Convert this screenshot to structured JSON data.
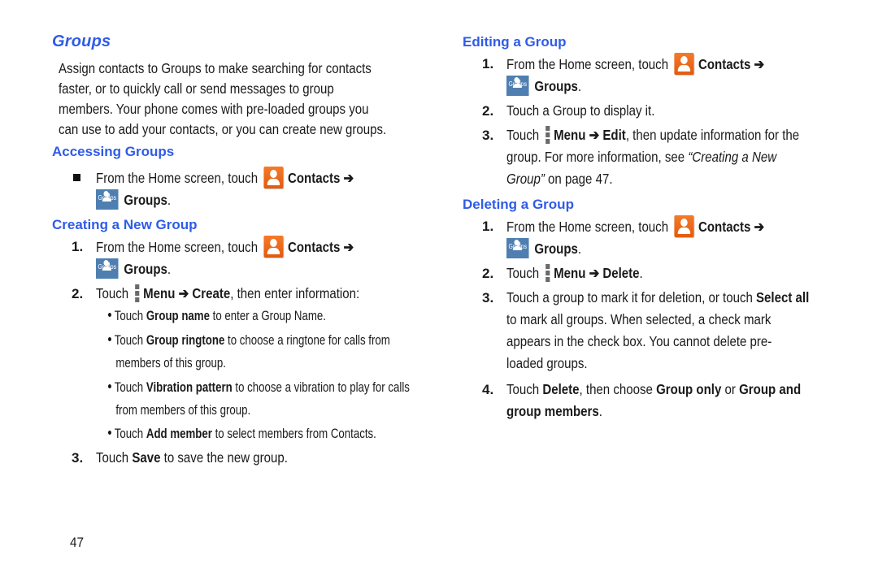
{
  "page": {
    "title": "Groups",
    "intro": [
      "Assign contacts to Groups to make searching for contacts",
      "faster, or to quickly call or send messages to group",
      "members. Your phone comes with pre-loaded groups you",
      "can use to add your contacts, or you can create new groups."
    ],
    "page_number": "47"
  },
  "common": {
    "from_home": "From the Home screen, touch ",
    "contacts": "Contacts",
    "arrow": " ➔",
    "groups": "Groups",
    "period": ".",
    "touch": "Touch ",
    "menu": "Menu",
    "arrow_mid": " ➔ "
  },
  "icons": {
    "contacts": "contacts-app-icon",
    "groups": "groups-app-icon",
    "groups_label": "Groups",
    "menu": "menu-dots-icon",
    "bullet": "square-bullet"
  },
  "accessing": {
    "heading": "Accessing Groups"
  },
  "creating": {
    "heading": "Creating a New Group",
    "step2_action": "Create",
    "step2_rest": ", then enter information:",
    "bullets": [
      {
        "pre": "Touch ",
        "bold": "Group name",
        "post": " to enter a Group Name."
      },
      {
        "pre": "Touch ",
        "bold": "Group ringtone",
        "post": " to choose a ringtone for calls from",
        "line2": "members of this group."
      },
      {
        "pre": "Touch ",
        "bold": "Vibration pattern",
        "post": " to choose a vibration to play for calls",
        "line2": "from members of this group."
      },
      {
        "pre": "Touch ",
        "bold": "Add member",
        "post": " to select members from Contacts."
      }
    ],
    "step3_pre": "Touch ",
    "step3_bold": "Save",
    "step3_post": " to save the new group."
  },
  "editing": {
    "heading": "Editing a Group",
    "step2": "Touch a Group to display it.",
    "step3_action": "Edit",
    "step3_rest": ", then update information for the",
    "step3_line2_pre": "group. For more information, see ",
    "step3_line2_ref": "“Creating a New",
    "step3_line3_ref": "Group”",
    "step3_line3_post": " on page 47."
  },
  "deleting": {
    "heading": "Deleting a Group",
    "step2_action": "Delete",
    "step3_pre": "Touch a group to mark it for deletion, or touch ",
    "step3_bold": "Select all",
    "step3_lines": [
      "to mark all groups. When selected, a check mark",
      "appears in the check box. You cannot delete pre-",
      "loaded groups."
    ],
    "step4_pre": "Touch ",
    "step4_b1": "Delete",
    "step4_mid": ", then choose ",
    "step4_b2": "Group only",
    "step4_or": " or ",
    "step4_b3": "Group and",
    "step4_b3_line2": "group members",
    "step4_end": "."
  },
  "numbers": [
    "1.",
    "2.",
    "3.",
    "4."
  ]
}
